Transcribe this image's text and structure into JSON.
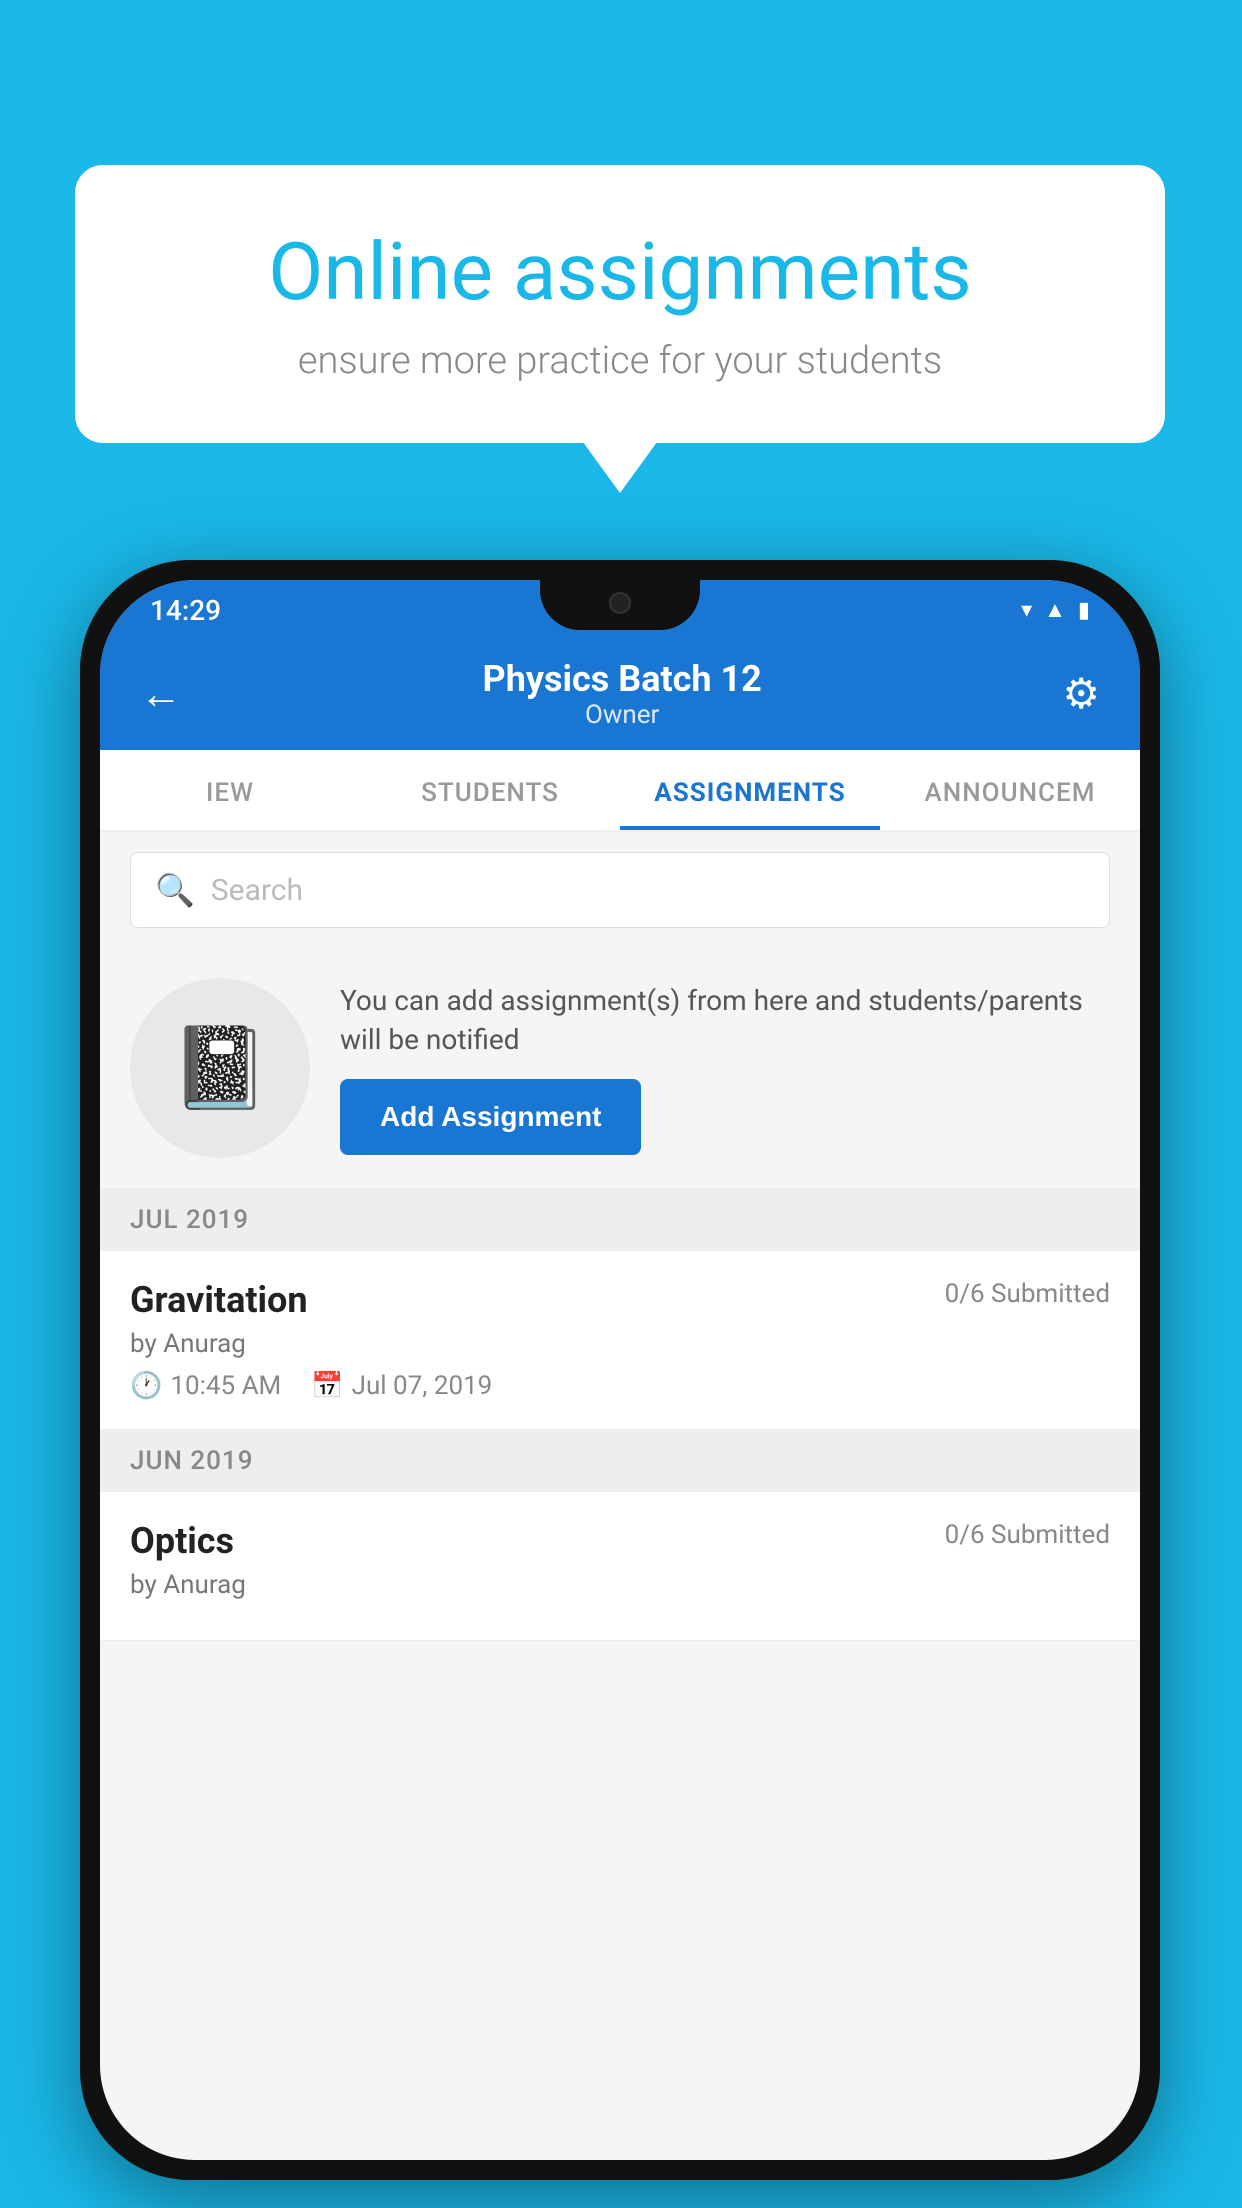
{
  "background": {
    "color": "#1ab8e8"
  },
  "speech_bubble": {
    "title": "Online assignments",
    "subtitle": "ensure more practice for your students"
  },
  "phone": {
    "status_bar": {
      "time": "14:29",
      "icons": [
        "wifi",
        "signal",
        "battery"
      ]
    },
    "header": {
      "title": "Physics Batch 12",
      "subtitle": "Owner",
      "back_label": "←",
      "gear_label": "⚙"
    },
    "tabs": [
      {
        "id": "overview",
        "label": "IEW",
        "active": false
      },
      {
        "id": "students",
        "label": "STUDENTS",
        "active": false
      },
      {
        "id": "assignments",
        "label": "ASSIGNMENTS",
        "active": true
      },
      {
        "id": "announcements",
        "label": "ANNOUNCEM",
        "active": false
      }
    ],
    "search": {
      "placeholder": "Search"
    },
    "promo": {
      "text": "You can add assignment(s) from here and students/parents will be notified",
      "button_label": "Add Assignment"
    },
    "sections": [
      {
        "label": "JUL 2019",
        "assignments": [
          {
            "name": "Gravitation",
            "author": "by Anurag",
            "submitted": "0/6 Submitted",
            "time": "10:45 AM",
            "date": "Jul 07, 2019"
          }
        ]
      },
      {
        "label": "JUN 2019",
        "assignments": [
          {
            "name": "Optics",
            "author": "by Anurag",
            "submitted": "0/6 Submitted",
            "time": "",
            "date": ""
          }
        ]
      }
    ]
  }
}
